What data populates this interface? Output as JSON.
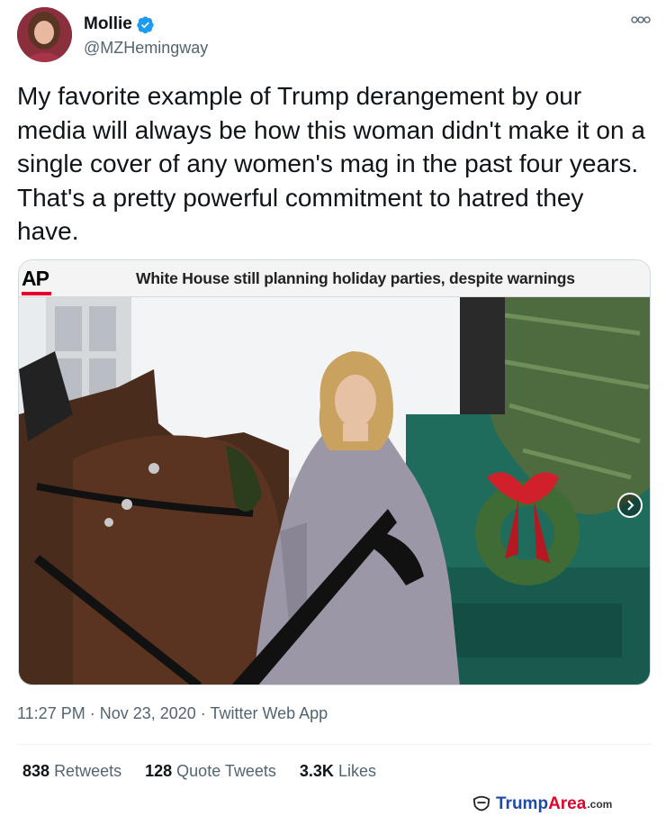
{
  "author": {
    "name": "Mollie",
    "handle": "@MZHemingway",
    "verified": true
  },
  "more_icon": "more-options-icon",
  "tweet": {
    "text": "My favorite example of Trump derangement by our media will always be how this woman didn't make it on a single cover of any women's mag in the past four years. That's a pretty powerful commitment to hatred they have."
  },
  "media": {
    "source_logo": "AP",
    "headline": "White House still planning holiday parties, despite warnings",
    "next_icon": "chevron-right-icon"
  },
  "meta": {
    "timestamp": "11:27 PM · Nov 23, 2020 · Twitter Web App"
  },
  "stats": [
    {
      "count": "838",
      "label": "Retweets"
    },
    {
      "count": "128",
      "label": "Quote Tweets"
    },
    {
      "count": "3.3K",
      "label": "Likes"
    }
  ],
  "watermark": {
    "brand_trump": "Trump",
    "brand_area": "Area",
    "tld": ".com"
  },
  "colors": {
    "verified_blue": "#1d9bf0",
    "secondary_text": "#536471",
    "ap_red": "#e4002b",
    "watermark_blue": "#1d4aa8"
  }
}
